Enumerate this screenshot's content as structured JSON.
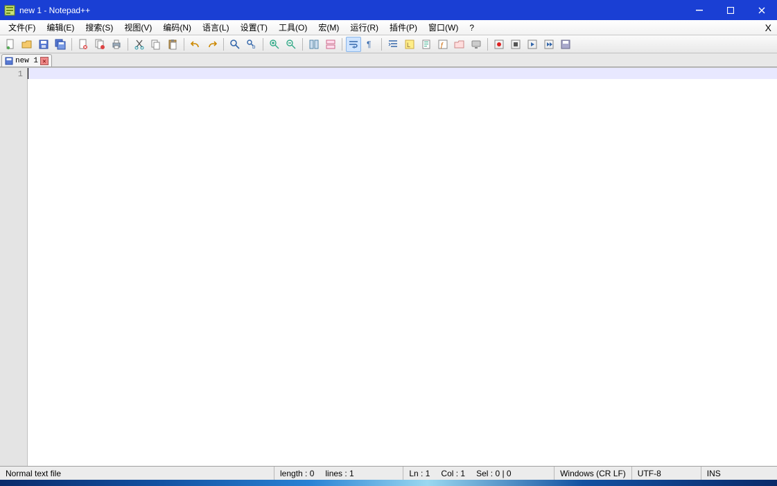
{
  "title": "new 1 - Notepad++",
  "menu": {
    "items": [
      "文件(F)",
      "编辑(E)",
      "搜索(S)",
      "视图(V)",
      "编码(N)",
      "语言(L)",
      "设置(T)",
      "工具(O)",
      "宏(M)",
      "运行(R)",
      "插件(P)",
      "窗口(W)",
      "?"
    ],
    "close_x": "X"
  },
  "toolbar_icons": [
    "new-file-icon",
    "open-file-icon",
    "save-icon",
    "save-all-icon",
    "sep",
    "close-icon",
    "close-all-icon",
    "print-icon",
    "sep",
    "cut-icon",
    "copy-icon",
    "paste-icon",
    "sep",
    "undo-icon",
    "redo-icon",
    "sep",
    "find-icon",
    "replace-icon",
    "sep",
    "zoom-in-icon",
    "zoom-out-icon",
    "sep",
    "sync-v-icon",
    "sync-h-icon",
    "sep",
    "word-wrap-icon",
    "show-all-chars-icon",
    "sep",
    "indent-guide-icon",
    "user-lang-icon",
    "doc-map-icon",
    "func-list-icon",
    "folder-icon",
    "monitor-icon",
    "sep",
    "record-icon",
    "stop-icon",
    "play-icon",
    "play-multi-icon",
    "save-macro-icon"
  ],
  "tabs": [
    {
      "label": "new 1"
    }
  ],
  "editor": {
    "line_number": "1"
  },
  "status": {
    "filetype": "Normal text file",
    "length": "length : 0",
    "lines": "lines : 1",
    "ln": "Ln : 1",
    "col": "Col : 1",
    "sel": "Sel : 0 | 0",
    "eol": "Windows (CR LF)",
    "encoding": "UTF-8",
    "mode": "INS"
  }
}
